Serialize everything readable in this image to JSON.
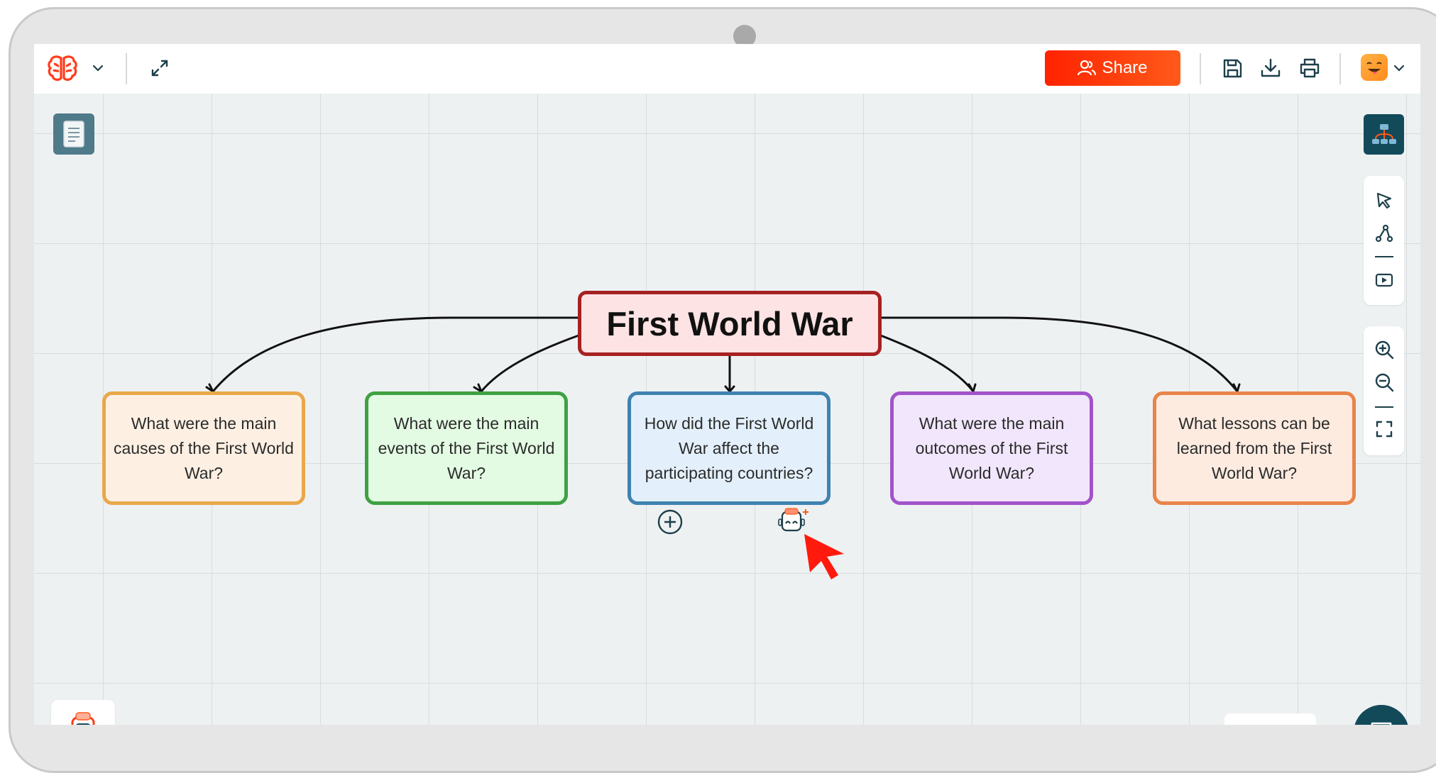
{
  "app": {
    "logo_icon": "brain-logo-icon",
    "brand_color": "#ff3b1a"
  },
  "toolbar": {
    "share_label": "Share",
    "icons": [
      "chevron-down-icon",
      "expand-icon",
      "save-icon",
      "download-icon",
      "print-icon",
      "avatar-icon"
    ]
  },
  "mindmap": {
    "root": {
      "label": "First World War",
      "border": "#a62121",
      "fill": "#fde3e3"
    },
    "children": [
      {
        "label": "What were the main causes of the First World War?",
        "border": "#e8a84a",
        "fill": "#fdf0e3"
      },
      {
        "label": "What were the main events of the First World War?",
        "border": "#3fa142",
        "fill": "#e3fbe3"
      },
      {
        "label": "How did the First World War affect the participating countries?",
        "border": "#3f82b0",
        "fill": "#e3f0fb"
      },
      {
        "label": "What were the main outcomes of the First World War?",
        "border": "#a253c9",
        "fill": "#f1e6fb"
      },
      {
        "label": "What lessons can be learned from the First World War?",
        "border": "#e8844a",
        "fill": "#fdebe0"
      }
    ]
  },
  "right_tools": [
    "select-tool-icon",
    "connect-nodes-icon",
    "video-icon",
    "zoom-in-icon",
    "zoom-out-icon",
    "fit-screen-icon"
  ],
  "accent_dark": "#124a5a"
}
